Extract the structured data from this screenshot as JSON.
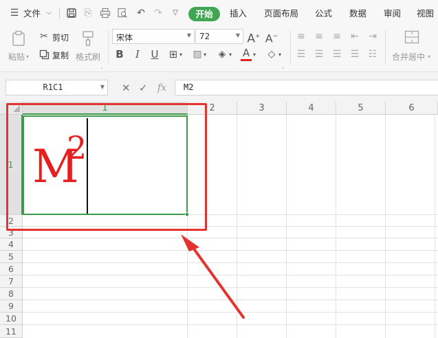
{
  "menu": {
    "file_label": "文件",
    "tabs": [
      "开始",
      "插入",
      "页面布局",
      "公式",
      "数据",
      "审阅",
      "视图"
    ]
  },
  "ribbon": {
    "paste_label": "粘贴",
    "cut_label": "剪切",
    "copy_label": "复制",
    "format_painter_label": "格式刷",
    "font_name": "宋体",
    "font_size": "72",
    "merge_center_label": "合并居中"
  },
  "formula_bar": {
    "name_box": "R1C1",
    "formula_value": "M2",
    "fx_label": "fx"
  },
  "grid": {
    "columns": [
      "1",
      "2",
      "3",
      "4",
      "5",
      "6"
    ],
    "rows": [
      "1",
      "2",
      "3",
      "4",
      "5",
      "6",
      "7",
      "8",
      "9",
      "10",
      "11"
    ],
    "cell_base": "M",
    "cell_superscript": "2"
  },
  "colors": {
    "accent_green": "#41a653",
    "text_red": "#e41f1f",
    "annotation_red": "#e3332e"
  }
}
